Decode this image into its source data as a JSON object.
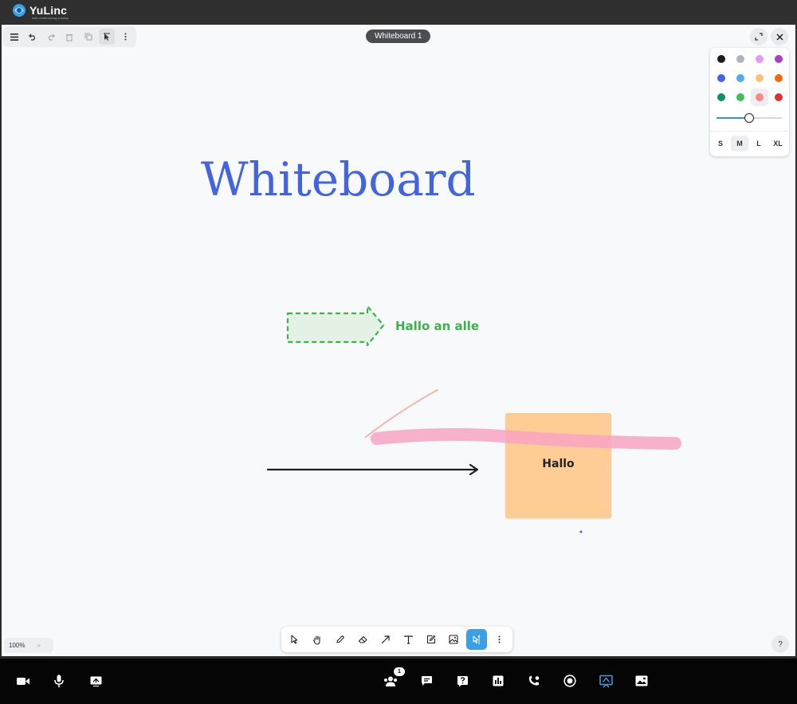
{
  "app": {
    "brand": "YuLinc",
    "brand_tagline": "web conferencing solution"
  },
  "board": {
    "title": "Whiteboard 1",
    "zoom": "100%",
    "zoom_toggle": "»",
    "help": "?",
    "canvas": {
      "heading": "Whiteboard",
      "arrow_label": "Hallo an alle",
      "sticky_note": "Hallo"
    }
  },
  "style_panel": {
    "colors": [
      "#1e1e1e",
      "#adb5bd",
      "#e599f7",
      "#ae3ec9",
      "#4263eb",
      "#4dabf7",
      "#ffc078",
      "#f76707",
      "#099268",
      "#40c057",
      "#ff8787",
      "#e03131"
    ],
    "selected_color": "#ff8787",
    "opacity_percent": 50,
    "sizes": [
      "S",
      "M",
      "L",
      "XL"
    ],
    "selected_size": "M"
  },
  "colors": {
    "accent": "#3aa0e3",
    "heading": "#4264e0",
    "label": "#3cb34a",
    "sticky": "#ffc98a",
    "highlighter": "#f8a5c2"
  },
  "participants_count": "1"
}
